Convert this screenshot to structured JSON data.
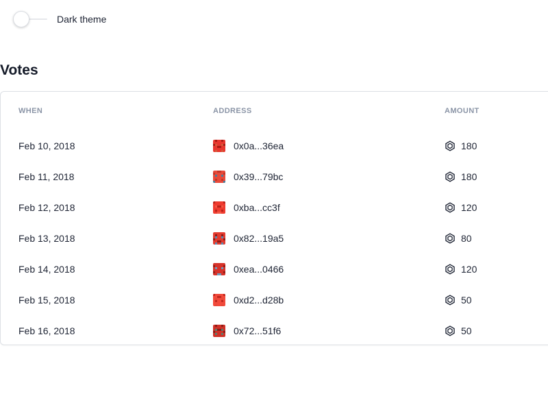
{
  "settings": {
    "dark_theme_label": "Dark theme",
    "dark_theme_on": false
  },
  "votes": {
    "title": "Votes",
    "columns": {
      "when": "WHEN",
      "address": "ADDRESS",
      "amount": "AMOUNT"
    },
    "rows": [
      {
        "when": "Feb 10, 2018",
        "address": "0x0a...36ea",
        "amount": "180",
        "avatar": "identicon-avatar",
        "colors": [
          "#e8362e",
          "#a81c14",
          "#d45a3a"
        ]
      },
      {
        "when": "Feb 11, 2018",
        "address": "0x39...79bc",
        "amount": "180",
        "avatar": "identicon-avatar",
        "colors": [
          "#e84a3a",
          "#c43527",
          "#4a7f9c"
        ]
      },
      {
        "when": "Feb 12, 2018",
        "address": "0xba...cc3f",
        "amount": "120",
        "avatar": "identicon-avatar",
        "colors": [
          "#ef3b2f",
          "#b8231a",
          "#f05a46"
        ]
      },
      {
        "when": "Feb 13, 2018",
        "address": "0x82...19a5",
        "amount": "80",
        "avatar": "identicon-avatar",
        "colors": [
          "#e33a2e",
          "#8f1d18",
          "#5b8bb0"
        ]
      },
      {
        "when": "Feb 14, 2018",
        "address": "0xea...0466",
        "amount": "120",
        "avatar": "identicon-avatar",
        "colors": [
          "#d6332a",
          "#9a1d15",
          "#6f9bbb"
        ]
      },
      {
        "when": "Feb 15, 2018",
        "address": "0xd2...d28b",
        "amount": "50",
        "avatar": "identicon-avatar",
        "colors": [
          "#f24a3b",
          "#c0281f",
          "#e84a3a"
        ]
      },
      {
        "when": "Feb 16, 2018",
        "address": "0x72...51f6",
        "amount": "50",
        "avatar": "identicon-avatar",
        "colors": [
          "#cf3127",
          "#8e1c15",
          "#5f7c6c"
        ]
      }
    ],
    "amount_icon": "token-hexagon-icon"
  }
}
